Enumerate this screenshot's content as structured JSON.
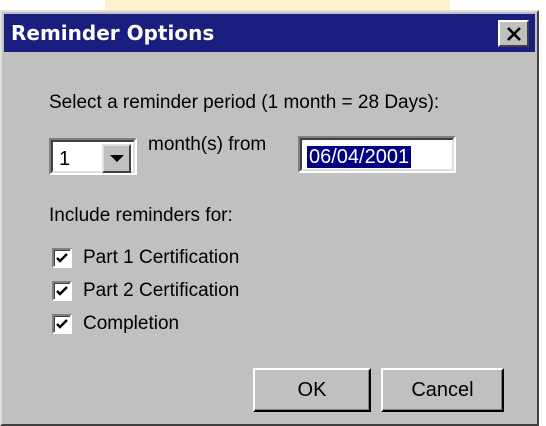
{
  "dialog": {
    "title": "Reminder Options",
    "close_label": "×"
  },
  "period": {
    "prompt": "Select a reminder period (1 month = 28 Days):",
    "months_value": "1",
    "months_label": "month(s) from",
    "start_date": "06/04/2001"
  },
  "include": {
    "heading": "Include reminders for:",
    "items": [
      {
        "label": "Part 1 Certification",
        "checked": true
      },
      {
        "label": "Part 2 Certification",
        "checked": true
      },
      {
        "label": "Completion",
        "checked": true
      }
    ]
  },
  "buttons": {
    "ok": "OK",
    "cancel": "Cancel"
  },
  "colors": {
    "titlebar": "#1a1e7e",
    "face": "#c0c0c0",
    "selection": "#000080"
  },
  "icons": {
    "close": "close-icon",
    "dropdown": "chevron-down-icon",
    "check": "checkmark-icon"
  }
}
